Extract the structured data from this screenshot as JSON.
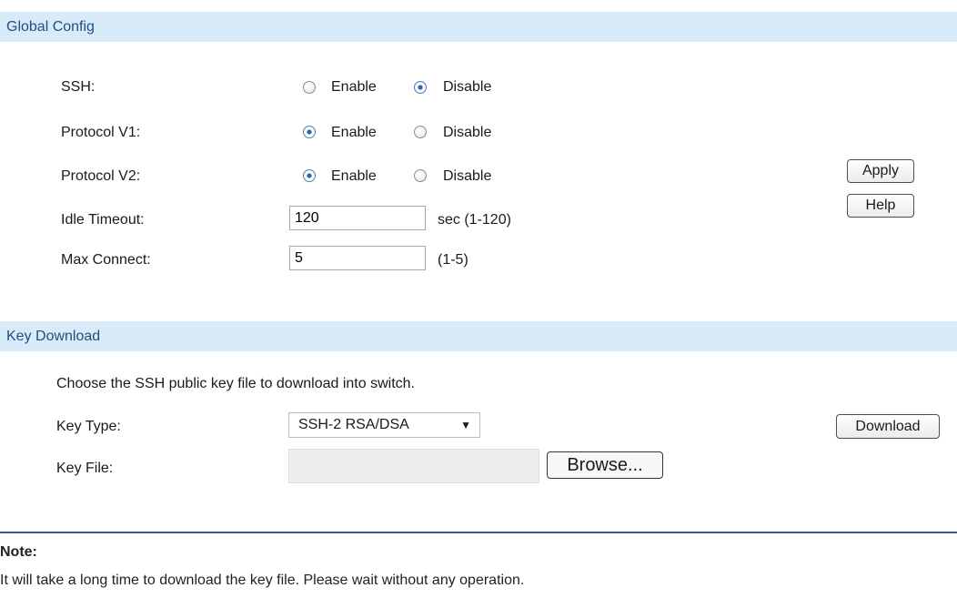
{
  "global_config": {
    "title": "Global Config",
    "ssh": {
      "label": "SSH:",
      "enable": "Enable",
      "disable": "Disable",
      "selected": "Disable"
    },
    "protocol_v1": {
      "label": "Protocol V1:",
      "enable": "Enable",
      "disable": "Disable",
      "selected": "Enable"
    },
    "protocol_v2": {
      "label": "Protocol V2:",
      "enable": "Enable",
      "disable": "Disable",
      "selected": "Enable"
    },
    "idle_timeout": {
      "label": "Idle Timeout:",
      "value": "120",
      "hint": "sec (1-120)"
    },
    "max_connect": {
      "label": "Max Connect:",
      "value": "5",
      "hint": "(1-5)"
    },
    "apply_label": "Apply",
    "help_label": "Help"
  },
  "key_download": {
    "title": "Key Download",
    "description": "Choose the SSH public key file to download into switch.",
    "key_type": {
      "label": "Key Type:",
      "selected": "SSH-2 RSA/DSA"
    },
    "key_file": {
      "label": "Key File:",
      "value": "",
      "browse_label": "Browse..."
    },
    "download_label": "Download"
  },
  "note": {
    "title": "Note:",
    "text": "It will take a long time to download the key file. Please wait without any operation."
  },
  "colors": {
    "header_bg": "#d9eaf9",
    "header_text": "#1f4f82",
    "divider": "#2b5d93",
    "radio_checked": "#1f5da6"
  }
}
